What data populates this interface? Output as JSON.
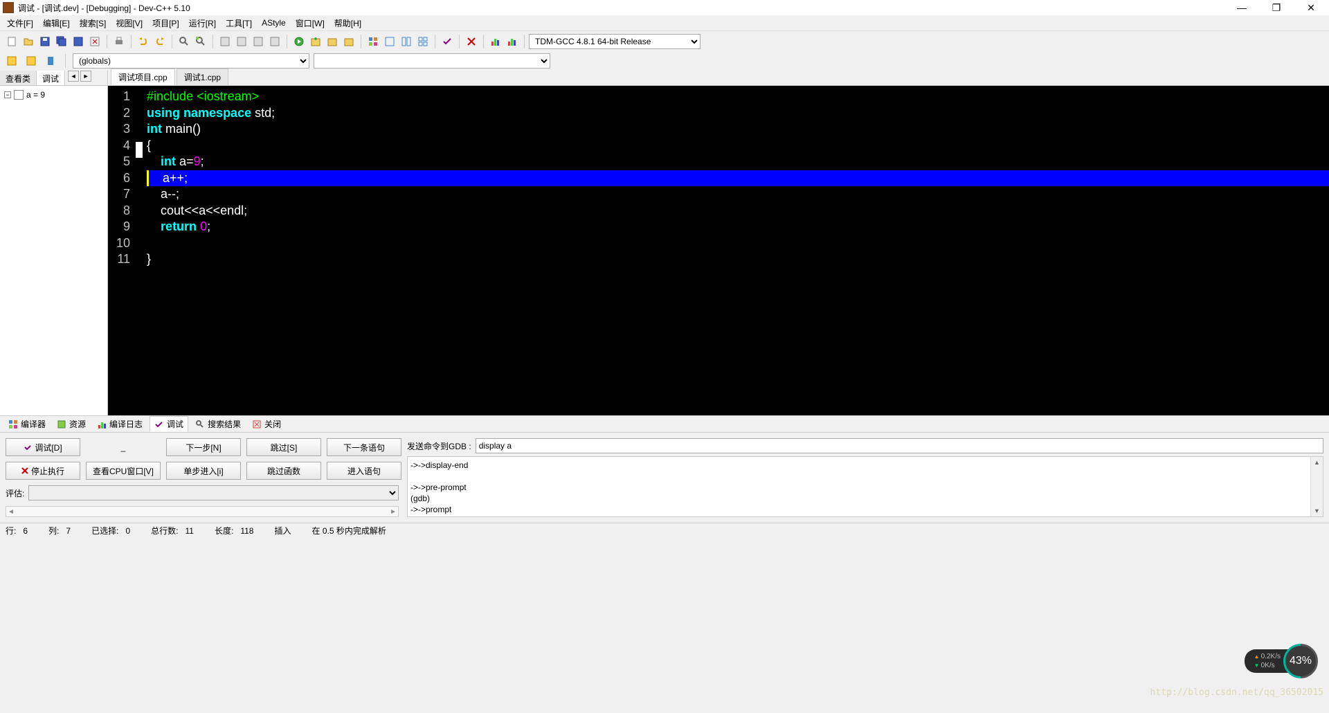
{
  "title": "调试 - [调试.dev] - [Debugging] - Dev-C++ 5.10",
  "menus": [
    "文件[F]",
    "编辑[E]",
    "搜索[S]",
    "视图[V]",
    "项目[P]",
    "运行[R]",
    "工具[T]",
    "AStyle",
    "窗口[W]",
    "帮助[H]"
  ],
  "compiler_select": "TDM-GCC 4.8.1 64-bit Release",
  "toolbar2_select": "(globals)",
  "side_tabs": {
    "browse": "查看类",
    "debug": "调试"
  },
  "tree_item": "a = 9",
  "file_tabs": {
    "active": "调试项目.cpp",
    "other": "调试1.cpp"
  },
  "code_lines": [
    {
      "n": 1,
      "seg": [
        {
          "t": "#include ",
          "c": "pp"
        },
        {
          "t": "<iostream>",
          "c": "pp"
        }
      ]
    },
    {
      "n": 2,
      "seg": [
        {
          "t": "using ",
          "c": "kw"
        },
        {
          "t": "namespace ",
          "c": "kw"
        },
        {
          "t": "std",
          "c": "id"
        },
        {
          "t": ";",
          "c": "op"
        }
      ]
    },
    {
      "n": 3,
      "seg": [
        {
          "t": "int ",
          "c": "kw"
        },
        {
          "t": "main",
          "c": "fn"
        },
        {
          "t": "()",
          "c": "op"
        }
      ]
    },
    {
      "n": 4,
      "seg": [
        {
          "t": "{",
          "c": "op"
        }
      ],
      "fold": true
    },
    {
      "n": 5,
      "seg": [
        {
          "t": "    ",
          "c": "op"
        },
        {
          "t": "int ",
          "c": "kw"
        },
        {
          "t": "a",
          "c": "id"
        },
        {
          "t": "=",
          "c": "op"
        },
        {
          "t": "9",
          "c": "num"
        },
        {
          "t": ";",
          "c": "op"
        }
      ]
    },
    {
      "n": 6,
      "seg": [
        {
          "t": "    a",
          "c": "id"
        },
        {
          "t": "++;",
          "c": "op"
        }
      ],
      "hl": true
    },
    {
      "n": 7,
      "seg": [
        {
          "t": "    a",
          "c": "id"
        },
        {
          "t": "--;",
          "c": "op"
        }
      ]
    },
    {
      "n": 8,
      "seg": [
        {
          "t": "    cout",
          "c": "id"
        },
        {
          "t": "<<",
          "c": "op"
        },
        {
          "t": "a",
          "c": "id"
        },
        {
          "t": "<<",
          "c": "op"
        },
        {
          "t": "endl",
          "c": "id"
        },
        {
          "t": ";",
          "c": "op"
        }
      ]
    },
    {
      "n": 9,
      "seg": [
        {
          "t": "    ",
          "c": "op"
        },
        {
          "t": "return ",
          "c": "kw"
        },
        {
          "t": "0",
          "c": "num"
        },
        {
          "t": ";",
          "c": "op"
        }
      ]
    },
    {
      "n": 10,
      "seg": []
    },
    {
      "n": 11,
      "seg": [
        {
          "t": "}",
          "c": "op"
        }
      ]
    }
  ],
  "bottom_tabs": {
    "compiler": "编译器",
    "resources": "资源",
    "log": "编译日志",
    "debug": "调试",
    "search": "搜索结果",
    "close": "关闭"
  },
  "debug_buttons": {
    "debug": "调试[D]",
    "stop": "停止执行",
    "cpu": "查看CPU窗口[V]",
    "next": "下一步[N]",
    "step_into": "单步进入[i]",
    "skip": "跳过[S]",
    "skip_fn": "跳过函数",
    "next_stmt": "下一条语句",
    "into_stmt": "进入语句"
  },
  "eval_label": "评估:",
  "gdb_label": "发送命令到GDB :",
  "gdb_input": "display a",
  "gdb_output": [
    "->->display-end",
    "",
    "->->pre-prompt",
    "(gdb)",
    "->->prompt"
  ],
  "status": {
    "line_lbl": "行:",
    "line": "6",
    "col_lbl": "列:",
    "col": "7",
    "sel_lbl": "已选择:",
    "sel": "0",
    "total_lbl": "总行数:",
    "total": "11",
    "len_lbl": "长度:",
    "len": "118",
    "mode": "插入",
    "parse": "在 0.5 秒内完成解析"
  },
  "net": {
    "up": "0.2K/s",
    "down": "0K/s",
    "pct": "43%"
  },
  "watermark": "http://blog.csdn.net/qq_36502015"
}
